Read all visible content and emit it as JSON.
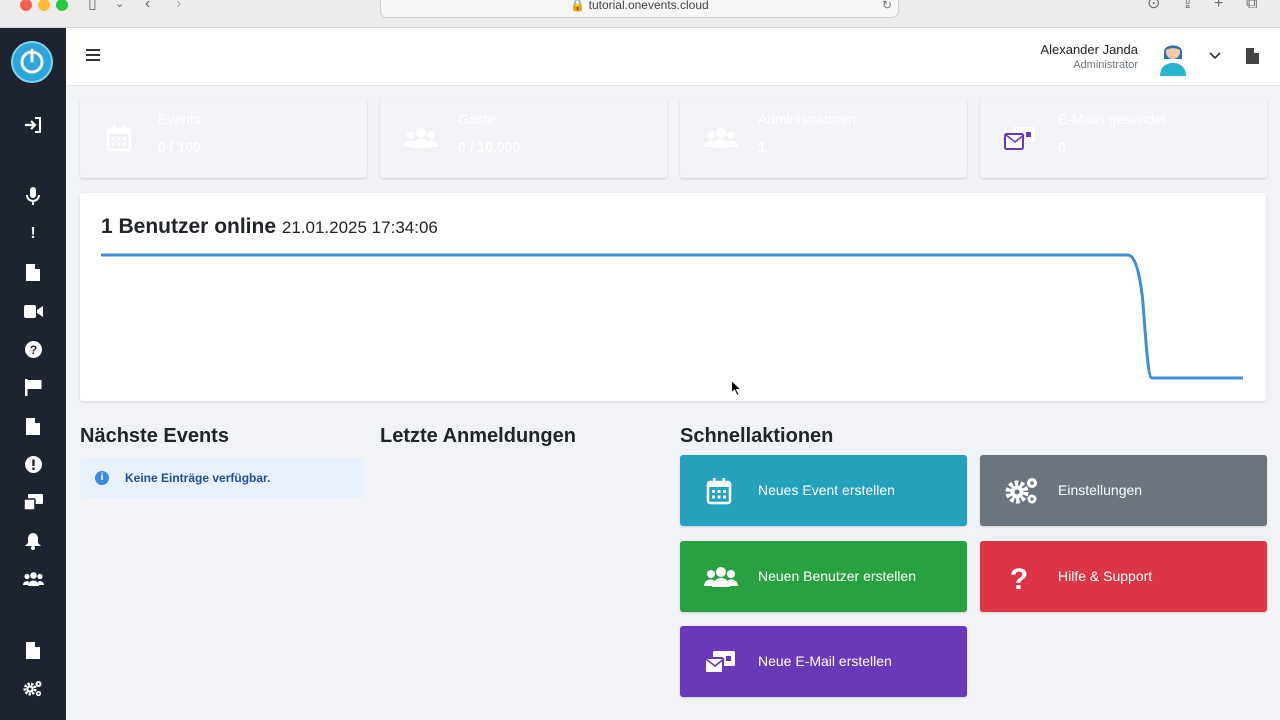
{
  "browser": {
    "url": "tutorial.onevents.cloud"
  },
  "header": {
    "user_name": "Alexander Janda",
    "user_role": "Administrator"
  },
  "stats": [
    {
      "label": "Events",
      "value": "0 / 100",
      "icon": "calendar-icon",
      "color": "#25a1bd"
    },
    {
      "label": "Gäste",
      "value": "0 / 10.000",
      "icon": "users-icon",
      "color": "#28a142"
    },
    {
      "label": "Administratoren",
      "value": "1",
      "icon": "users-icon",
      "color": "#dc3545"
    },
    {
      "label": "E-Mails gesendet",
      "value": "0",
      "icon": "mail-icon",
      "color": "#6a39b9"
    }
  ],
  "online": {
    "title": "1 Benutzer online",
    "timestamp": "21.01.2025 17:34:06",
    "line_color": "#3d8fd6"
  },
  "sections": {
    "next_events": "Nächste Events",
    "last_logins": "Letzte Anmeldungen",
    "quick_actions": "Schnellaktionen"
  },
  "empty_message": "Keine Einträge verfügbar.",
  "actions": [
    {
      "label": "Neues Event erstellen",
      "icon": "calendar-icon",
      "color": "#25a1bd"
    },
    {
      "label": "Einstellungen",
      "icon": "gears-icon",
      "color": "#6c757d"
    },
    {
      "label": "Neuen Benutzer erstellen",
      "icon": "users-icon",
      "color": "#28a142"
    },
    {
      "label": "Hilfe & Support",
      "icon": "question-icon",
      "color": "#dc3545"
    },
    {
      "label": "Neue E-Mail erstellen",
      "icon": "mail-icon",
      "color": "#6a39b9"
    }
  ]
}
